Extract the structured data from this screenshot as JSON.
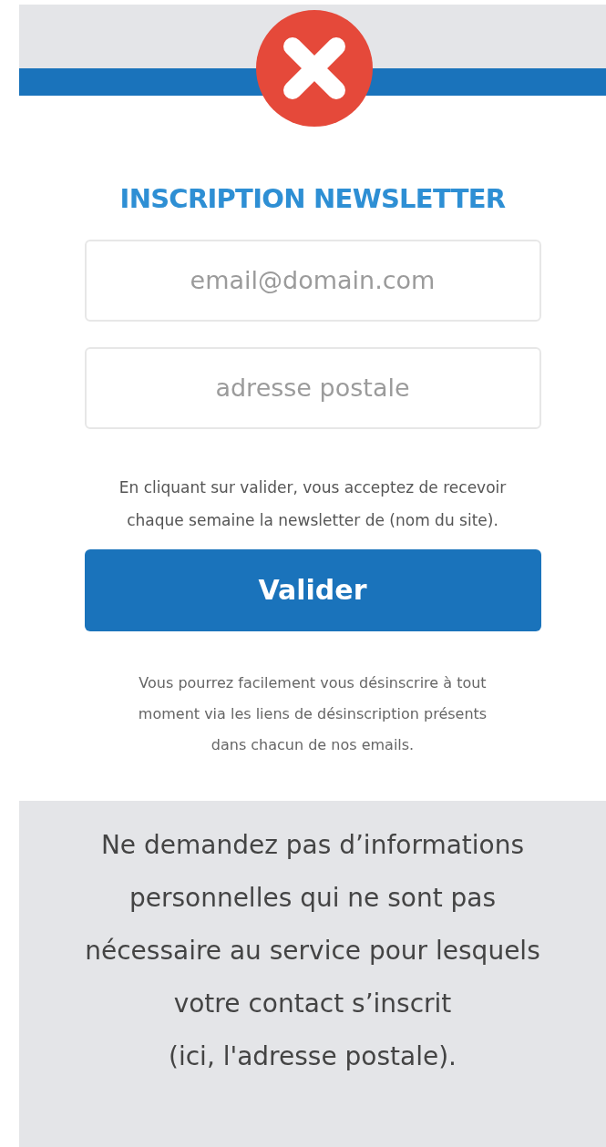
{
  "card": {
    "title": "INSCRIPTION NEWSLETTER",
    "fields": [
      {
        "placeholder": "email@domain.com"
      },
      {
        "placeholder": "adresse postale"
      }
    ],
    "consent": "En cliquant sur valider, vous acceptez de recevoir\nchaque semaine la newsletter de (nom du site).",
    "button": "Valider",
    "note": "Vous pourrez facilement vous désinscrire à tout\nmoment via les liens de désinscription présents\ndans chacun de nos emails."
  },
  "caption": "Ne demandez pas d’informations\npersonnelles qui ne sont pas\nnécessaire au service pour lesquels\nvotre contact s’inscrit\n(ici, l'adresse postale)."
}
